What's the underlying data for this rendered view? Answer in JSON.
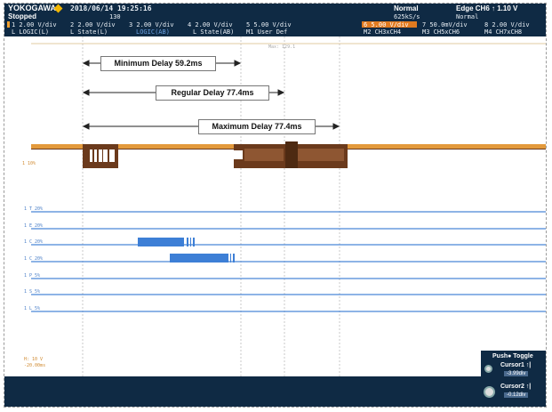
{
  "header": {
    "brand": "YOKOGAWA",
    "status": "Stopped",
    "datetime": "2018/06/14 19:25:16",
    "count": "130",
    "mode": "Normal",
    "sample_rate": "625kS/s",
    "trigger_mode": "Normal",
    "trigger": "Edge CH6 ↑ 1.10 V",
    "channels_row1": [
      "1 2.00 V/div",
      "2 2.00 V/div",
      "3 2.00 V/div",
      "4 2.00 V/div",
      "5 5.00 V/div",
      "6 5.00 V/div",
      "7 50.0mV/div",
      "8 2.00 V/div"
    ],
    "channels_row2": [
      "L LOGIC(L)",
      "L State(L)",
      "LOGIC(AB)",
      "L State(AB)",
      "M1 User Def",
      "M2 CH3xCH4",
      "M3 CH5xCH6",
      "M4 CH7xCH8"
    ],
    "chip_colors": {
      "ch1": "#f0a030",
      "ch6": "#e07a20"
    }
  },
  "plot": {
    "background": "#ffffff",
    "grid_color": "#c8c8c8",
    "orange_trace": "#e39a3c",
    "dark_trace": "#6b3a1c",
    "digital_color": "#3d7fd6",
    "top_marker": "Max: 129.1",
    "ch1_label": "1 10%",
    "channel_labels": [
      "1 T  20%",
      "1 E  20%",
      "1 C  20%",
      "1 C  20%",
      "1 P  5%",
      "1 S  5%",
      "1 L  5%"
    ],
    "bottom_label_1": "H: 10 V",
    "bottom_label_2": "-20.00ms",
    "annotations": {
      "min": "Minimum Delay 59.2ms",
      "regular": "Regular Delay 77.4ms",
      "max": "Maximum Delay 77.4ms"
    }
  },
  "cursor_panel": {
    "title": "Push● Toggle",
    "cursor1_label": "Cursor1 ↑|",
    "cursor1_value": "-3.99div",
    "cursor2_label": "Cursor2 ↑|",
    "cursor2_value": "-0.12div"
  }
}
